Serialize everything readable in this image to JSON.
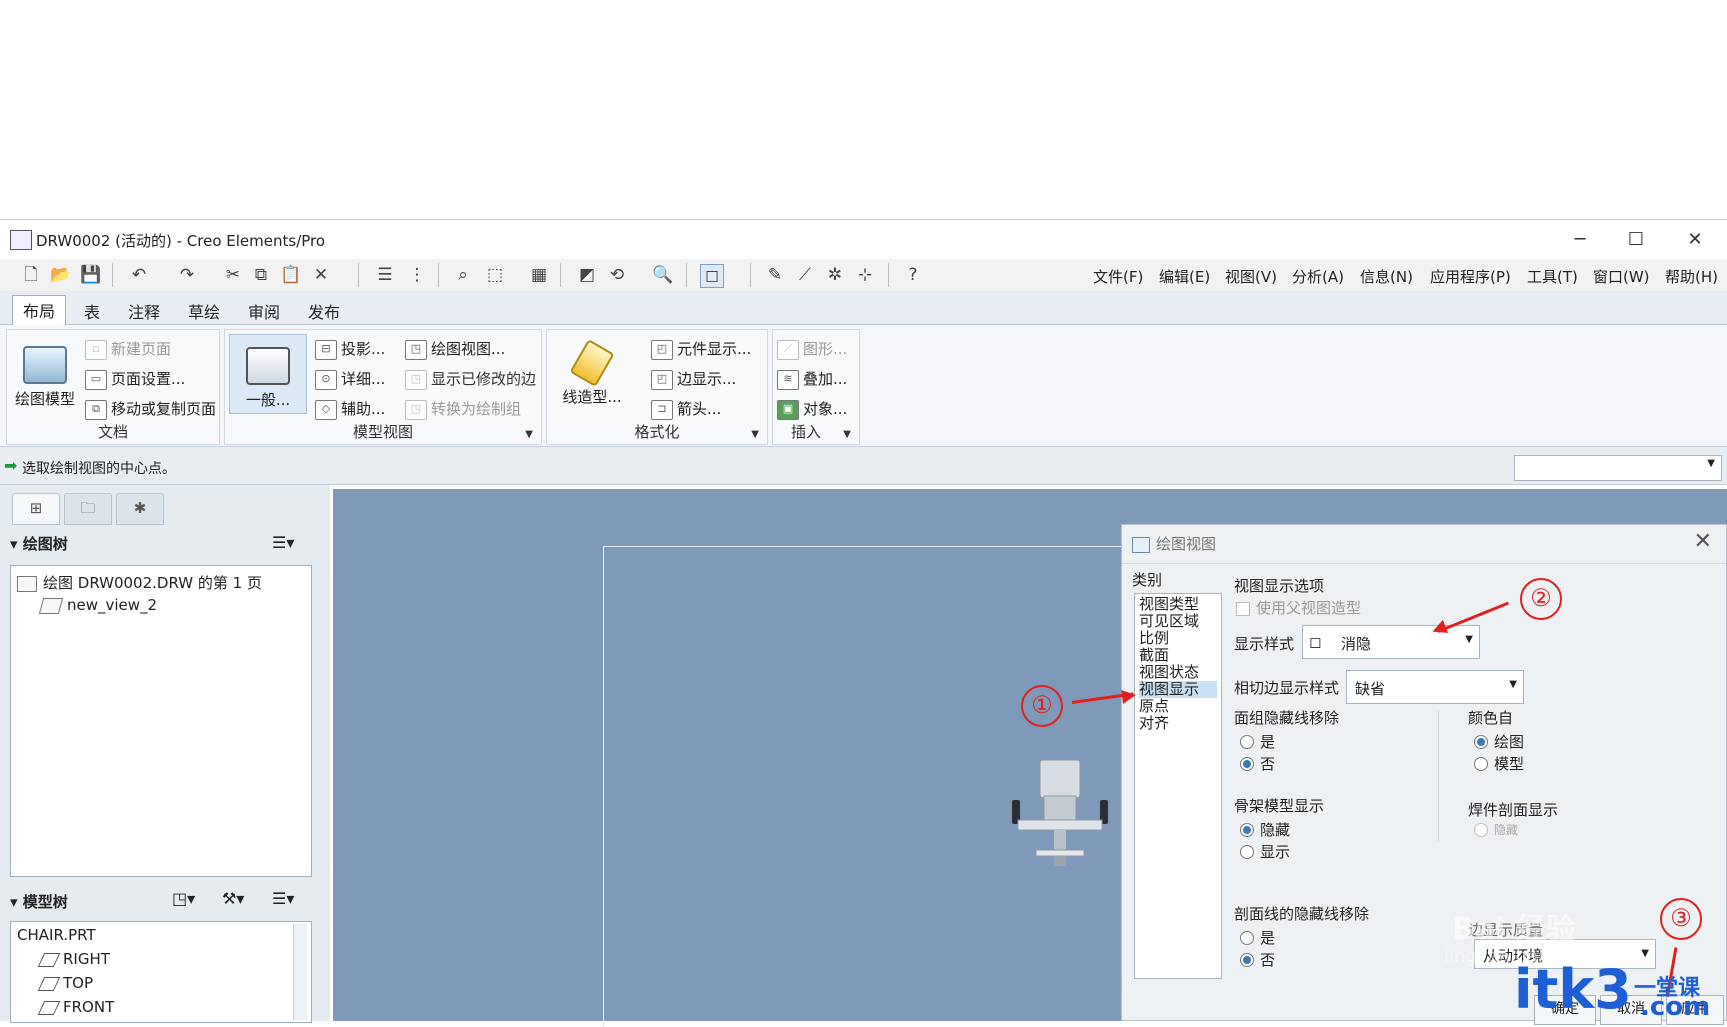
{
  "window": {
    "title": "DRW0002 (活动的) - Creo Elements/Pro",
    "minimize": "─",
    "maximize": "☐",
    "close": "✕"
  },
  "menu": [
    "文件(F)",
    "编辑(E)",
    "视图(V)",
    "分析(A)",
    "信息(N)",
    "应用程序(P)",
    "工具(T)",
    "窗口(W)",
    "帮助(H)"
  ],
  "ribbon_tabs": [
    "布局",
    "表",
    "注释",
    "草绘",
    "审阅",
    "发布"
  ],
  "ribbon": {
    "doc": {
      "label": "文档",
      "big": "绘图模型",
      "items": [
        "新建页面",
        "页面设置...",
        "移动或复制页面"
      ]
    },
    "model_view": {
      "label": "模型视图",
      "big": "一般...",
      "col1": [
        "投影...",
        "详细...",
        "辅助..."
      ],
      "col2": [
        "绘图视图...",
        "显示已修改的边",
        "转换为绘制组"
      ]
    },
    "format": {
      "label": "格式化",
      "big": "线造型...",
      "items": [
        "元件显示...",
        "边显示...",
        "箭头..."
      ]
    },
    "insert": {
      "label": "插入",
      "items": [
        "图形...",
        "叠加...",
        "对象..."
      ]
    }
  },
  "status": {
    "message": "选取绘制视图的中心点。"
  },
  "left_panel": {
    "drawing_tree_header": "绘图树",
    "drawing_tree": [
      "绘图 DRW0002.DRW 的第 1 页",
      "new_view_2"
    ],
    "model_tree_header": "模型树",
    "model_tree": [
      "CHAIR.PRT",
      "RIGHT",
      "TOP",
      "FRONT"
    ]
  },
  "dialog": {
    "title": "绘图视图",
    "category_label": "类别",
    "categories": [
      "视图类型",
      "可见区域",
      "比例",
      "截面",
      "视图状态",
      "视图显示",
      "原点",
      "对齐"
    ],
    "selected_category": "视图显示",
    "section_title": "视图显示选项",
    "use_parent_style": "使用父视图造型",
    "display_style_label": "显示样式",
    "display_style_value": "消隐",
    "tangent_label": "相切边显示样式",
    "tangent_value": "缺省",
    "face_group_label": "面组隐藏线移除",
    "face_group_options": [
      "是",
      "否"
    ],
    "color_from_label": "颜色自",
    "color_from_options": [
      "绘图",
      "模型"
    ],
    "skeleton_label": "骨架模型显示",
    "skeleton_options": [
      "隐藏",
      "显示"
    ],
    "weld_label": "焊件剖面显示",
    "weld_option": "隐藏",
    "hatch_label": "剖面线的隐藏线移除",
    "hatch_options": [
      "是",
      "否"
    ],
    "edge_display_label": "边显示质量",
    "edge_display_value": "从动环境",
    "buttons": [
      "确定",
      "取消",
      "应用"
    ]
  },
  "annotations": [
    "①",
    "②",
    "③"
  ],
  "watermarks": {
    "baidu": "Bai 经验",
    "baidu_url": "jingyan.baidu.com",
    "itk3": "itk3",
    "itk3_cn": "一堂课",
    "itk3_com": ".com"
  },
  "colors": {
    "canvas": "#7f9ab9",
    "annotation": "#e02020",
    "watermark": "#1e5fd8"
  }
}
